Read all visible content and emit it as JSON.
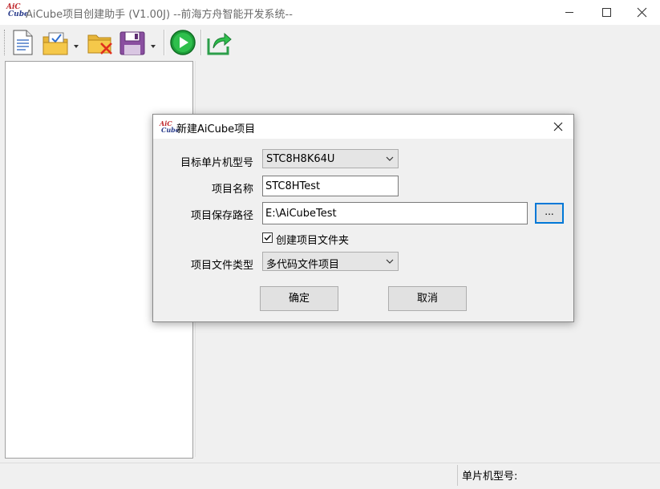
{
  "window": {
    "logo_line1": "AiC",
    "logo_line2": "Cube",
    "title": "AiCube项目创建助手 (V1.00J) --前海方舟智能开发系统--"
  },
  "toolbar": {
    "buttons": [
      "new-project-icon",
      "open-project-icon",
      "close-project-icon",
      "save-project-icon",
      "run-icon",
      "export-icon"
    ]
  },
  "status": {
    "mcu_label": "单片机型号:"
  },
  "dialog": {
    "logo_line1": "AiC",
    "logo_line2": "Cube",
    "title": "新建AiCube项目",
    "mcu_label": "目标单片机型号",
    "mcu_value": "STC8H8K64U",
    "name_label": "项目名称",
    "name_value": "STC8HTest",
    "path_label": "项目保存路径",
    "path_value": "E:\\AiCubeTest",
    "browse_label": "...",
    "create_folder_label": "创建项目文件夹",
    "create_folder_checked": true,
    "filetype_label": "项目文件类型",
    "filetype_value": "多代码文件项目",
    "ok_label": "确定",
    "cancel_label": "取消"
  },
  "colors": {
    "accent": "#0078d7",
    "logo_red": "#c0282d",
    "logo_blue": "#2b3d8c"
  }
}
